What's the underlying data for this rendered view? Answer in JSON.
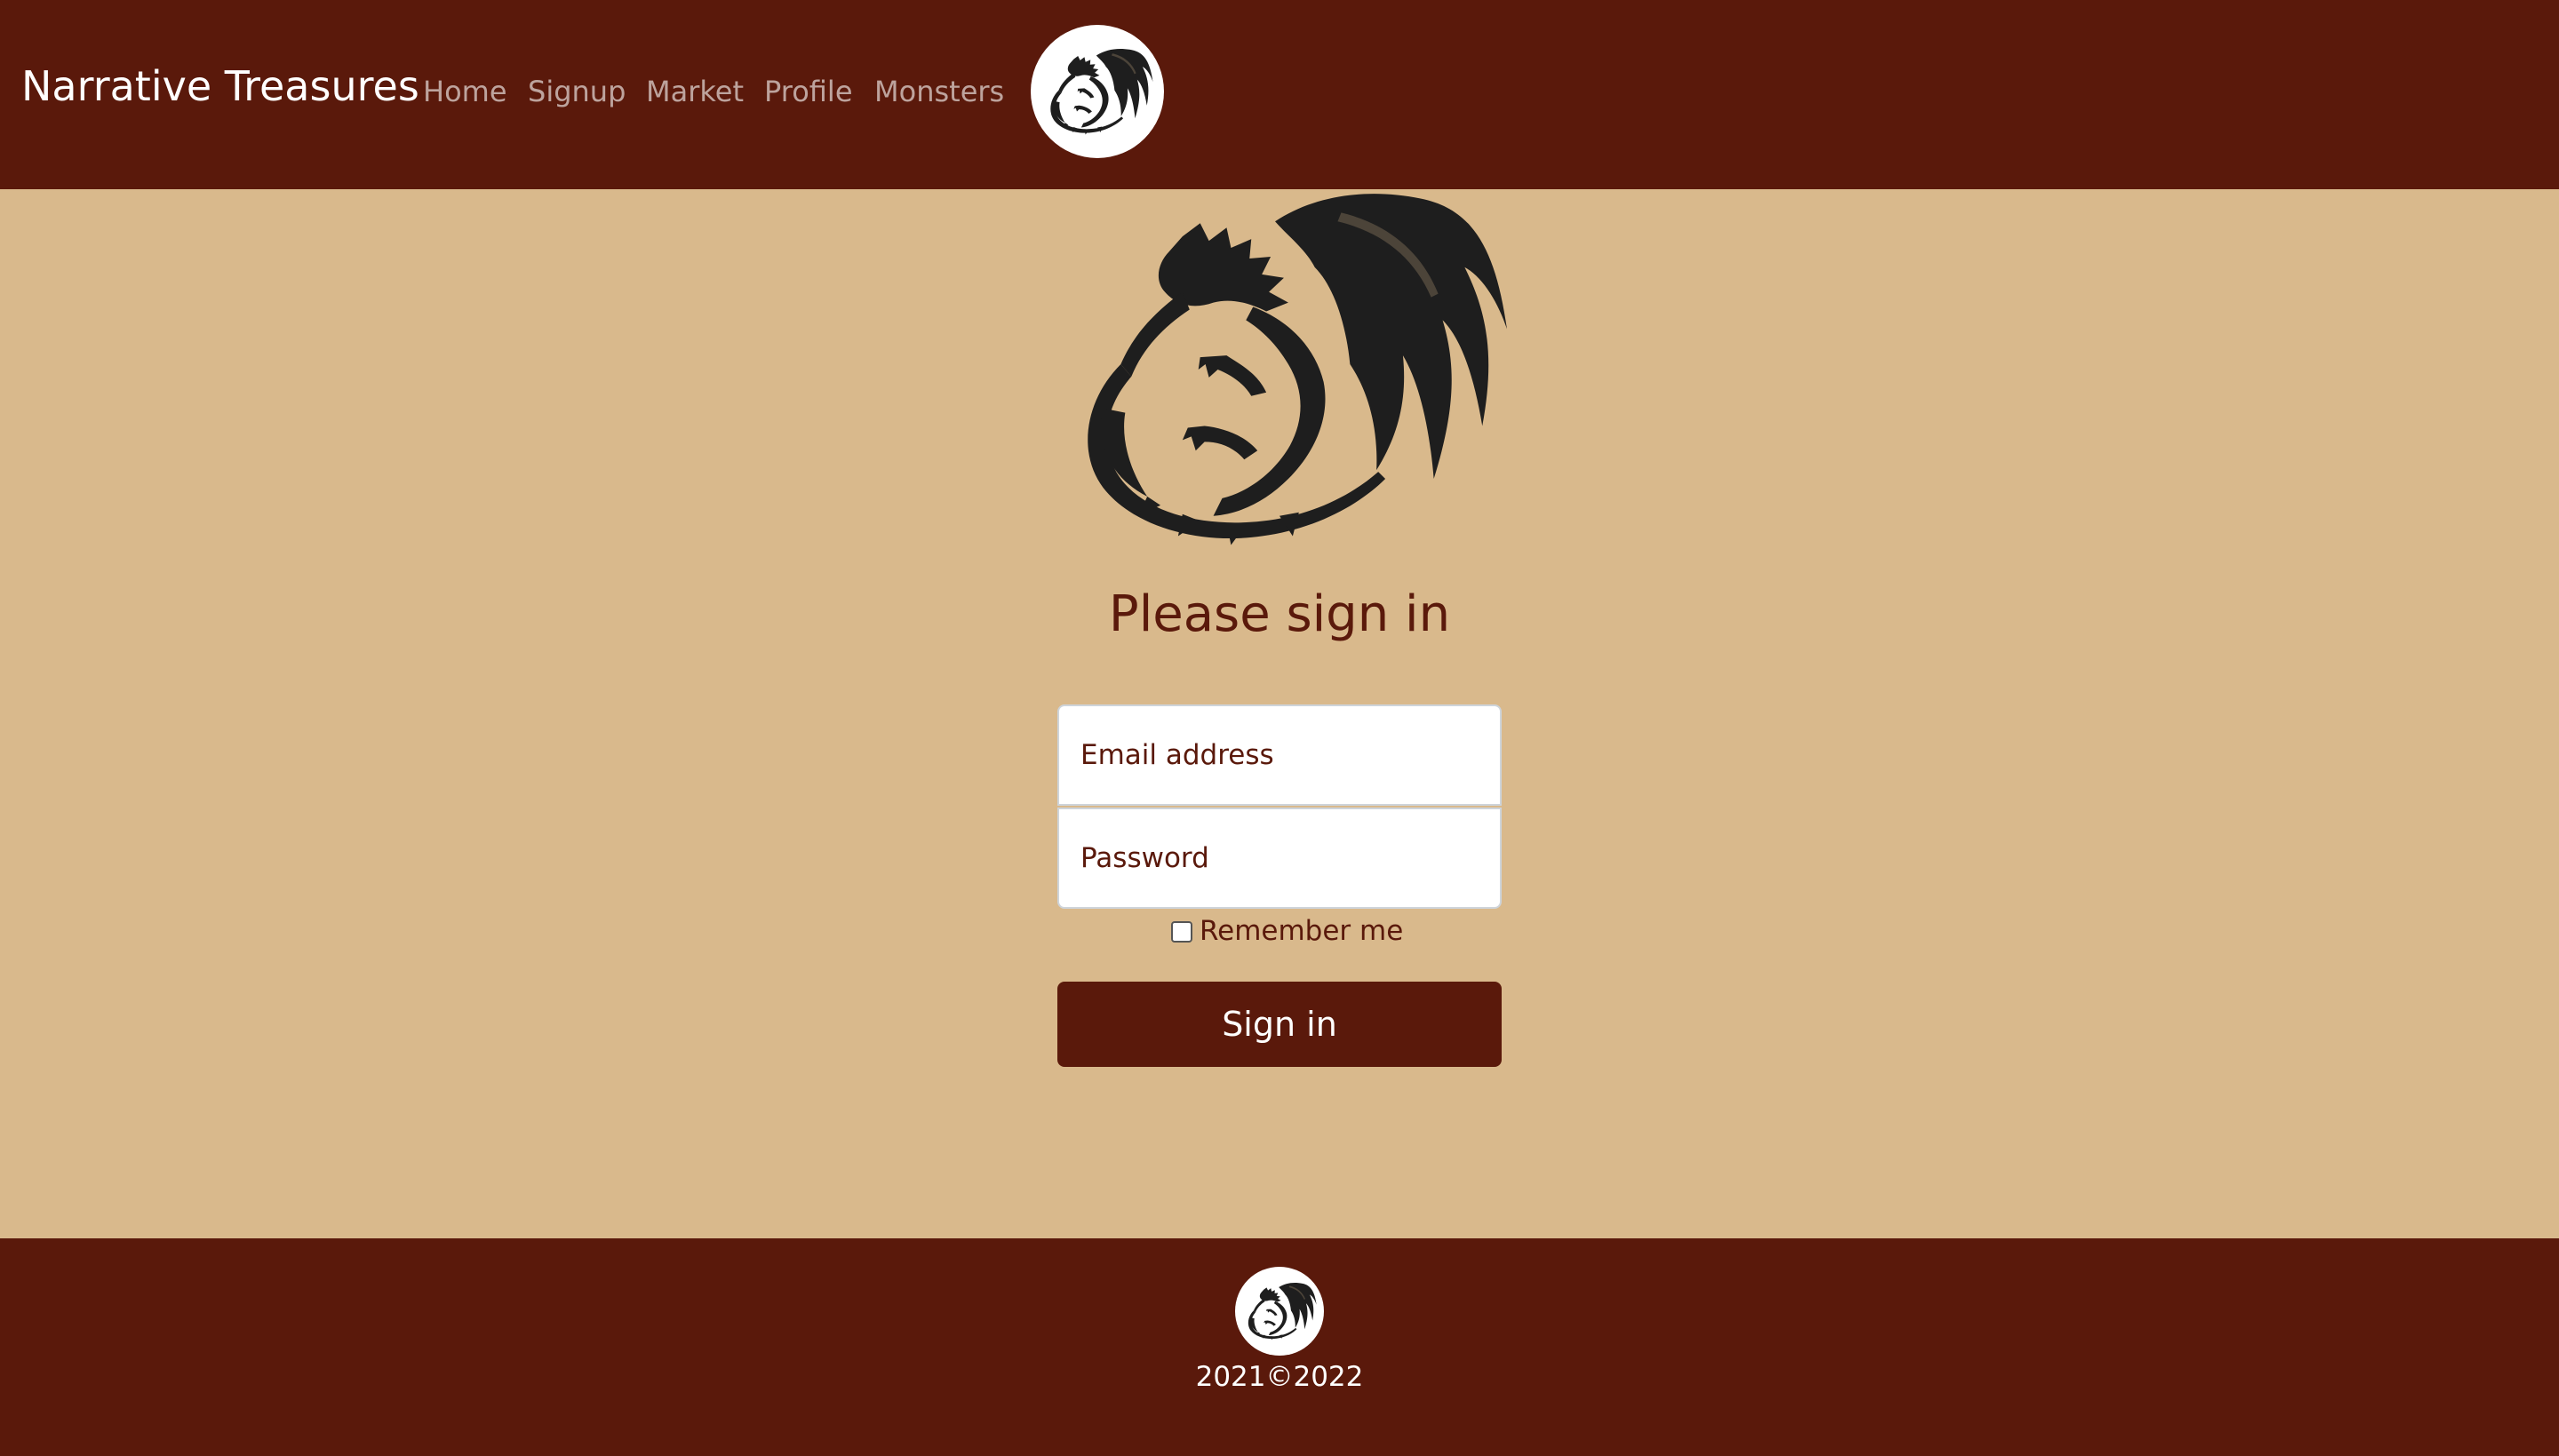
{
  "navbar": {
    "brand": "Narrative Treasures",
    "links": [
      "Home",
      "Signup",
      "Market",
      "Profile",
      "Monsters"
    ],
    "logo_icon": "dragon-logo-icon"
  },
  "login": {
    "heading": "Please sign in",
    "email_placeholder": "Email address",
    "password_placeholder": "Password",
    "remember_label": "Remember me",
    "remember_checked": false,
    "submit_label": "Sign in",
    "hero_icon": "dragon-emblem-icon"
  },
  "footer": {
    "copyright": "2021©2022",
    "logo_icon": "dragon-logo-icon"
  },
  "colors": {
    "primary": "#5a190b",
    "background": "#d9b98c",
    "text_on_primary": "#ffffff",
    "nav_link": "#b4a29f"
  }
}
